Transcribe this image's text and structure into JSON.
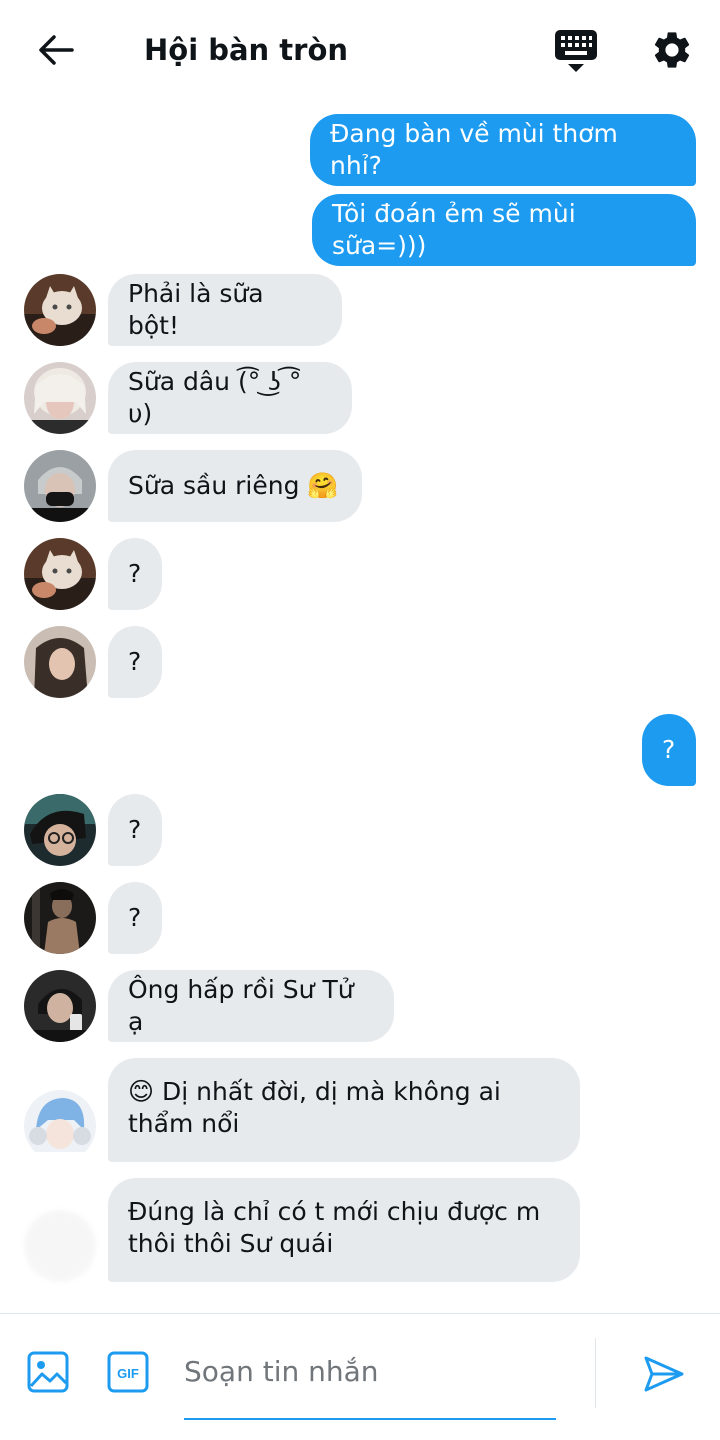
{
  "header": {
    "title": "Hội bàn tròn",
    "icons": [
      "back-arrow-icon",
      "keyboard-icon",
      "gear-icon"
    ]
  },
  "messages": [
    {
      "direction": "outgoing",
      "text": "Đang bàn về mùi thơm nhỉ?"
    },
    {
      "direction": "outgoing",
      "text": "Tôi đoán ẻm sẽ mùi sữa=)))"
    },
    {
      "direction": "incoming",
      "text": "Phải là sữa bột!"
    },
    {
      "direction": "incoming",
      "text": "Sữa dâu (͡° ͜ʖ ͡° υ)"
    },
    {
      "direction": "incoming",
      "text": "Sữa sầu riêng 🤗"
    },
    {
      "direction": "incoming",
      "text": "?"
    },
    {
      "direction": "incoming",
      "text": "?"
    },
    {
      "direction": "outgoing",
      "text": "?"
    },
    {
      "direction": "incoming",
      "text": "?"
    },
    {
      "direction": "incoming",
      "text": "?"
    },
    {
      "direction": "incoming",
      "text": "Ông hấp rồi Sư Tử ạ"
    },
    {
      "direction": "incoming",
      "text": "😊 Dị nhất đời, dị mà không ai thẩm nổi"
    },
    {
      "direction": "incoming",
      "text": "Đúng là chỉ có t mới chịu được m thôi thôi Sư quái"
    }
  ],
  "composer": {
    "placeholder": "Soạn tin nhắn",
    "icons": [
      "image-icon",
      "gif-icon",
      "send-icon"
    ]
  },
  "colors": {
    "accent": "#1d9bf0",
    "incoming_bubble": "#e7eaed",
    "text": "#0f1419",
    "placeholder": "#71767b"
  }
}
